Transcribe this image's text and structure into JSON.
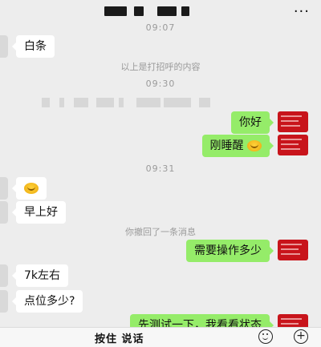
{
  "header": {
    "title": "",
    "more_icon": "more-dots-icon"
  },
  "messages": {
    "time1": "09:07",
    "m1_left": "白条",
    "sys1": "以上是打招呼的内容",
    "time2": "09:30",
    "m2_right": "你好",
    "m3_right": "刚睡醒",
    "time3": "09:31",
    "m4_left_emoji": "smile-emoji",
    "m5_left": "早上好",
    "sys2": "你撤回了一条消息",
    "m6_right": "需要操作多少",
    "m7_left": "7k左右",
    "m8_left": "点位多少?",
    "m9_right": "先测试一下，我看看状态"
  },
  "input_bar": {
    "hold_to_talk": "按住 说话",
    "emoji_icon": "emoji-icon",
    "plus_icon": "plus-icon"
  },
  "colors": {
    "background": "#ededed",
    "bubble_sent": "#95ec69",
    "bubble_received": "#ffffff",
    "avatar_right": "#c8141b"
  }
}
